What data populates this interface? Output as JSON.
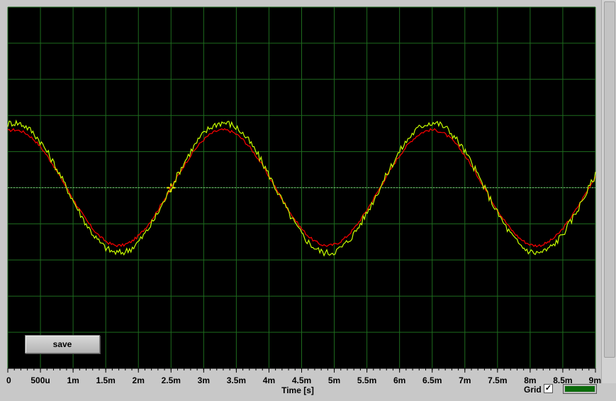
{
  "save_button": {
    "label": "save"
  },
  "grid_control": {
    "label": "Grid",
    "checked": true,
    "check_glyph": "✓",
    "color": "#0b6b0b"
  },
  "colors": {
    "plot_bg": "#000000",
    "grid": "#1e6b1e",
    "trace_1": "#ff0000",
    "trace_2": "#c8ff00",
    "cursor": "#ffff00"
  },
  "chart_data": {
    "type": "line",
    "xlabel": "Time [s]",
    "ylabel": "",
    "xlim": [
      0,
      0.009
    ],
    "ylim": [
      -5,
      5
    ],
    "grid": true,
    "x_ticks": [
      {
        "value": 0,
        "label": "0"
      },
      {
        "value": 0.0005,
        "label": "500u"
      },
      {
        "value": 0.001,
        "label": "1m"
      },
      {
        "value": 0.0015,
        "label": "1.5m"
      },
      {
        "value": 0.002,
        "label": "2m"
      },
      {
        "value": 0.0025,
        "label": "2.5m"
      },
      {
        "value": 0.003,
        "label": "3m"
      },
      {
        "value": 0.0035,
        "label": "3.5m"
      },
      {
        "value": 0.004,
        "label": "4m"
      },
      {
        "value": 0.0045,
        "label": "4.5m"
      },
      {
        "value": 0.005,
        "label": "5m"
      },
      {
        "value": 0.0055,
        "label": "5.5m"
      },
      {
        "value": 0.006,
        "label": "6m"
      },
      {
        "value": 0.0065,
        "label": "6.5m"
      },
      {
        "value": 0.007,
        "label": "7m"
      },
      {
        "value": 0.0075,
        "label": "7.5m"
      },
      {
        "value": 0.008,
        "label": "8m"
      },
      {
        "value": 0.0085,
        "label": "8.5m"
      },
      {
        "value": 0.009,
        "label": "9m"
      }
    ],
    "series": [
      {
        "color": "#ff0000",
        "waveform": "sine",
        "frequency_hz": 312.5,
        "amplitude": 1.6,
        "peak_time": 0.0033,
        "noise": 0.02
      },
      {
        "color": "#c8ff00",
        "waveform": "sine",
        "frequency_hz": 312.5,
        "amplitude": 1.8,
        "peak_time": 0.0033,
        "noise": 0.05
      }
    ],
    "cursor": {
      "x": 0.0025,
      "y": 0.0
    },
    "reference_line_y": 0
  }
}
